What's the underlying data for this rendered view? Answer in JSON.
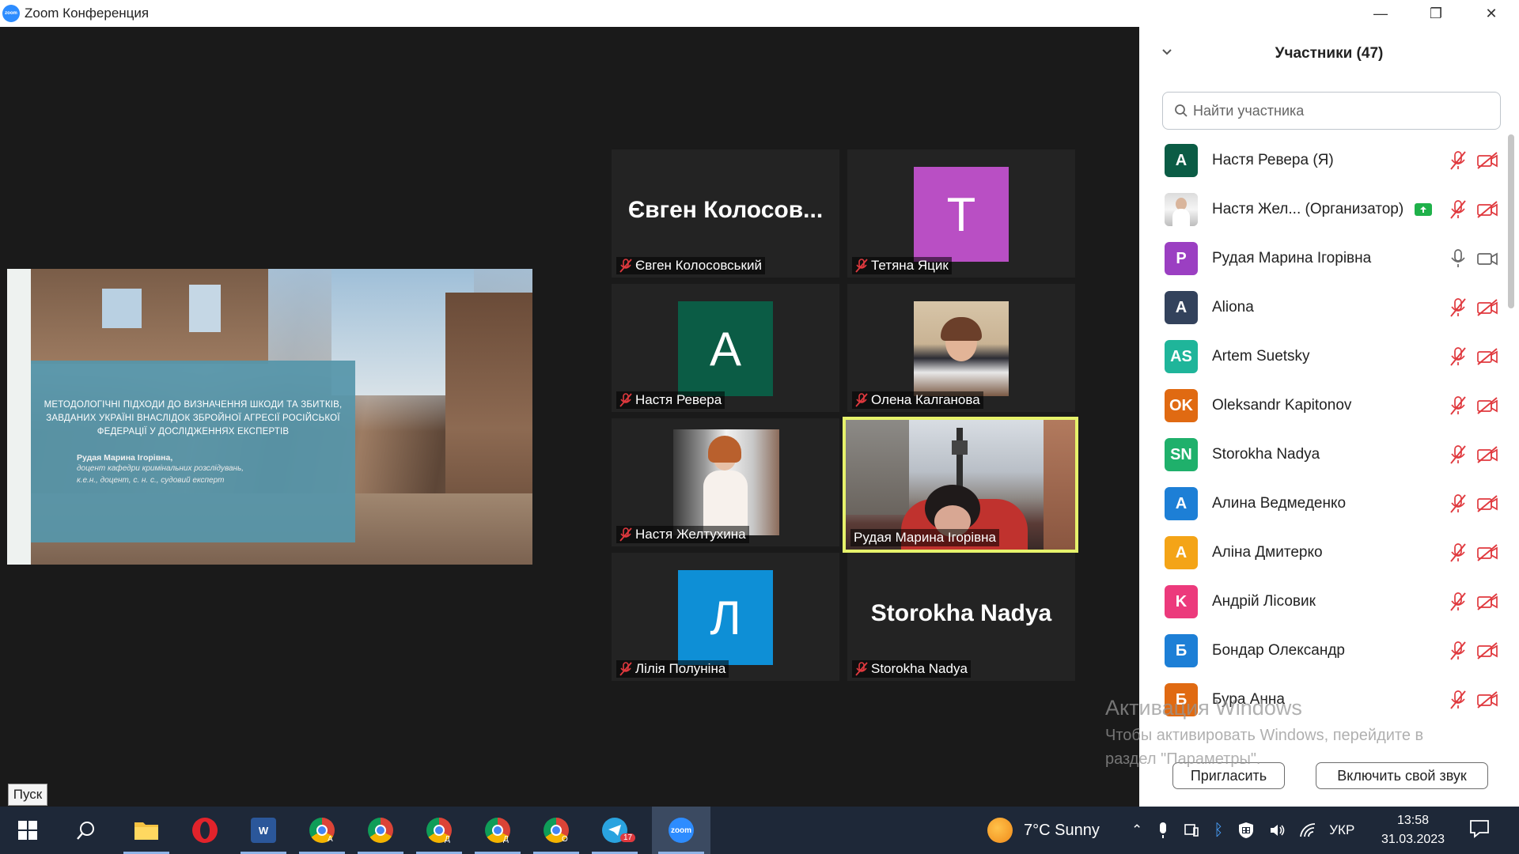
{
  "window": {
    "title": "Zoom Конференция",
    "logo_text": "zoom",
    "minimize": "—",
    "restore": "❐",
    "close": "✕"
  },
  "slide": {
    "heading": "МЕТОДОЛОГІЧНІ ПІДХОДИ ДО ВИЗНАЧЕННЯ ШКОДИ ТА ЗБИТКІВ, ЗАВДАНИХ УКРАЇНІ ВНАСЛІДОК ЗБРОЙНОЇ АГРЕСІЇ РОСІЙСЬКОЇ ФЕДЕРАЦІЇ У ДОСЛІДЖЕННЯХ ЕКСПЕРТІВ",
    "author": "Рудая Марина Ігорівна,",
    "role": "доцент кафедри кримінальних розслідувань, к.е.н., доцент, с. н. с., судовий експерт"
  },
  "tiles": [
    {
      "big_name": "Євген Колосов...",
      "name": "Євген Колосовський",
      "muted": true
    },
    {
      "avatar_letter": "Т",
      "avatar_color": "#b94fc4",
      "name": "Тетяна Яцик",
      "muted": true
    },
    {
      "avatar_letter": "A",
      "avatar_color": "#0b5c45",
      "name": "Настя Ревера",
      "muted": true
    },
    {
      "name": "Олена Калганова",
      "muted": true
    },
    {
      "name": "Настя Желтухина",
      "muted": true
    },
    {
      "name": "Рудая Марина Ігорівна",
      "muted": false,
      "speaking": true
    },
    {
      "avatar_letter": "Л",
      "avatar_color": "#0e8fd6",
      "name": "Лілія Полуніна",
      "muted": true
    },
    {
      "big_name": "Storokha Nadya",
      "name": "Storokha Nadya",
      "muted": true
    }
  ],
  "participants_panel": {
    "title": "Участники (47)",
    "search_placeholder": "Найти участника",
    "items": [
      {
        "initials": "A",
        "color": "#0b5c45",
        "name": "Настя Ревера (Я)",
        "muted": true,
        "video_off": true
      },
      {
        "initials": "",
        "color": "#d8d8d8",
        "name": "Настя Жел...  (Организатор)",
        "sharing": true,
        "muted": true,
        "video_off": true
      },
      {
        "initials": "P",
        "color": "#9b3fc2",
        "name": "Рудая Марина Ігорівна",
        "muted": false,
        "video_off": false
      },
      {
        "initials": "A",
        "color": "#33425c",
        "name": "Aliona",
        "muted": true,
        "video_off": true
      },
      {
        "initials": "AS",
        "color": "#1fb59a",
        "name": "Artem Suetsky",
        "muted": true,
        "video_off": true
      },
      {
        "initials": "OK",
        "color": "#e06a12",
        "name": "Oleksandr Kapitonov",
        "muted": true,
        "video_off": true
      },
      {
        "initials": "SN",
        "color": "#1fb06b",
        "name": "Storokha Nadya",
        "muted": true,
        "video_off": true
      },
      {
        "initials": "A",
        "color": "#1d7fd6",
        "name": "Алина Ведмеденко",
        "muted": true,
        "video_off": true
      },
      {
        "initials": "A",
        "color": "#f4a417",
        "name": "Аліна Дмитерко",
        "muted": true,
        "video_off": true
      },
      {
        "initials": "K",
        "color": "#ec3a7c",
        "name": "Андрій Лісовик",
        "muted": true,
        "video_off": true
      },
      {
        "initials": "Б",
        "color": "#1d7fd6",
        "name": "Бондар Олександр",
        "muted": true,
        "video_off": true
      },
      {
        "initials": "Б",
        "color": "#e06a12",
        "name": "Бура Анна",
        "muted": true,
        "video_off": true
      }
    ],
    "invite_label": "Пригласить",
    "unmute_label": "Включить свой звук"
  },
  "watermark": {
    "line1": "Активация Windows",
    "line2": "Чтобы активировать Windows, перейдите в",
    "line3": "раздел \"Параметры\"."
  },
  "start_tooltip": "Пуск",
  "taskbar": {
    "weather": "7°C  Sunny",
    "lang": "УКР",
    "time": "13:58",
    "date": "31.03.2023",
    "telegram_badge": "17",
    "chrome_badges": [
      "A",
      "",
      "Д",
      "Д",
      "O"
    ]
  },
  "colors": {
    "speaking_border": "#e6f26b",
    "muted_red": "#e0393e",
    "taskbar_bg": "#1e2838"
  }
}
